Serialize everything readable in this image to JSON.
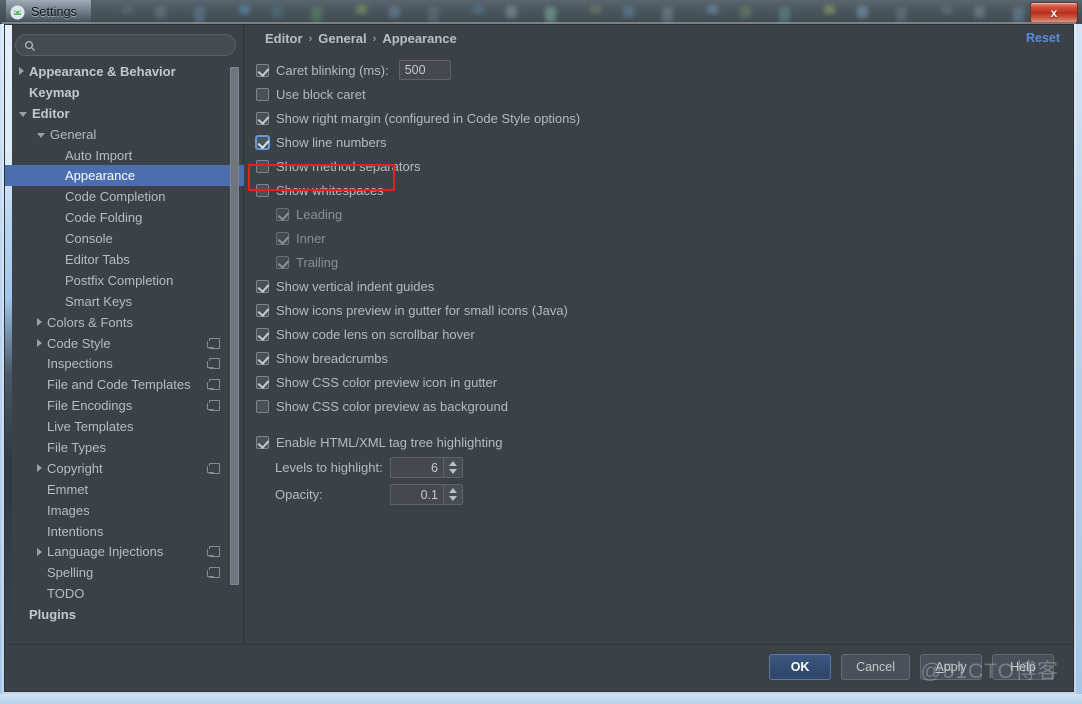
{
  "window": {
    "title": "Settings",
    "app_icon": "android-studio-icon",
    "close_label": "x"
  },
  "search": {
    "value": "",
    "placeholder": "",
    "icon": "search-icon"
  },
  "sidebar": {
    "items": [
      {
        "label": "Appearance & Behavior",
        "indent": 0,
        "twisty": "right",
        "bold": true,
        "selected": false,
        "badge": false
      },
      {
        "label": "Keymap",
        "indent": 0,
        "twisty": "none",
        "bold": true,
        "selected": false,
        "badge": false
      },
      {
        "label": "Editor",
        "indent": 0,
        "twisty": "down",
        "bold": true,
        "selected": false,
        "badge": false
      },
      {
        "label": "General",
        "indent": 1,
        "twisty": "down",
        "bold": false,
        "selected": false,
        "badge": false
      },
      {
        "label": "Auto Import",
        "indent": 2,
        "twisty": "none",
        "bold": false,
        "selected": false,
        "badge": false
      },
      {
        "label": "Appearance",
        "indent": 2,
        "twisty": "none",
        "bold": false,
        "selected": true,
        "badge": false
      },
      {
        "label": "Code Completion",
        "indent": 2,
        "twisty": "none",
        "bold": false,
        "selected": false,
        "badge": false
      },
      {
        "label": "Code Folding",
        "indent": 2,
        "twisty": "none",
        "bold": false,
        "selected": false,
        "badge": false
      },
      {
        "label": "Console",
        "indent": 2,
        "twisty": "none",
        "bold": false,
        "selected": false,
        "badge": false
      },
      {
        "label": "Editor Tabs",
        "indent": 2,
        "twisty": "none",
        "bold": false,
        "selected": false,
        "badge": false
      },
      {
        "label": "Postfix Completion",
        "indent": 2,
        "twisty": "none",
        "bold": false,
        "selected": false,
        "badge": false
      },
      {
        "label": "Smart Keys",
        "indent": 2,
        "twisty": "none",
        "bold": false,
        "selected": false,
        "badge": false
      },
      {
        "label": "Colors & Fonts",
        "indent": 1,
        "twisty": "right",
        "bold": false,
        "selected": false,
        "badge": false
      },
      {
        "label": "Code Style",
        "indent": 1,
        "twisty": "right",
        "bold": false,
        "selected": false,
        "badge": true
      },
      {
        "label": "Inspections",
        "indent": 1,
        "twisty": "none",
        "bold": false,
        "selected": false,
        "badge": true
      },
      {
        "label": "File and Code Templates",
        "indent": 1,
        "twisty": "none",
        "bold": false,
        "selected": false,
        "badge": true
      },
      {
        "label": "File Encodings",
        "indent": 1,
        "twisty": "none",
        "bold": false,
        "selected": false,
        "badge": true
      },
      {
        "label": "Live Templates",
        "indent": 1,
        "twisty": "none",
        "bold": false,
        "selected": false,
        "badge": false
      },
      {
        "label": "File Types",
        "indent": 1,
        "twisty": "none",
        "bold": false,
        "selected": false,
        "badge": false
      },
      {
        "label": "Copyright",
        "indent": 1,
        "twisty": "right",
        "bold": false,
        "selected": false,
        "badge": true
      },
      {
        "label": "Emmet",
        "indent": 1,
        "twisty": "none",
        "bold": false,
        "selected": false,
        "badge": false
      },
      {
        "label": "Images",
        "indent": 1,
        "twisty": "none",
        "bold": false,
        "selected": false,
        "badge": false
      },
      {
        "label": "Intentions",
        "indent": 1,
        "twisty": "none",
        "bold": false,
        "selected": false,
        "badge": false
      },
      {
        "label": "Language Injections",
        "indent": 1,
        "twisty": "right",
        "bold": false,
        "selected": false,
        "badge": true
      },
      {
        "label": "Spelling",
        "indent": 1,
        "twisty": "none",
        "bold": false,
        "selected": false,
        "badge": true
      },
      {
        "label": "TODO",
        "indent": 1,
        "twisty": "none",
        "bold": false,
        "selected": false,
        "badge": false
      },
      {
        "label": "Plugins",
        "indent": 0,
        "twisty": "none",
        "bold": true,
        "selected": false,
        "badge": false
      }
    ]
  },
  "main": {
    "breadcrumb": [
      "Editor",
      "General",
      "Appearance"
    ],
    "breadcrumb_separator": "›",
    "reset_label": "Reset",
    "options": [
      {
        "id": "caret-blinking",
        "label": "Caret blinking (ms):",
        "checked": true,
        "state": "normal",
        "indent": 0,
        "field": "500"
      },
      {
        "id": "use-block-caret",
        "label": "Use block caret",
        "checked": false,
        "state": "normal",
        "indent": 0
      },
      {
        "id": "show-right-margin",
        "label": "Show right margin (configured in Code Style options)",
        "checked": true,
        "state": "normal",
        "indent": 0
      },
      {
        "id": "show-line-numbers",
        "label": "Show line numbers",
        "checked": true,
        "state": "focus",
        "indent": 0
      },
      {
        "id": "show-method-separators",
        "label": "Show method separators",
        "checked": false,
        "state": "normal",
        "indent": 0
      },
      {
        "id": "show-whitespaces",
        "label": "Show whitespaces",
        "checked": false,
        "state": "normal",
        "indent": 0
      },
      {
        "id": "whitespace-leading",
        "label": "Leading",
        "checked": true,
        "state": "dimmed",
        "indent": 1
      },
      {
        "id": "whitespace-inner",
        "label": "Inner",
        "checked": true,
        "state": "dimmed",
        "indent": 1
      },
      {
        "id": "whitespace-trailing",
        "label": "Trailing",
        "checked": true,
        "state": "dimmed",
        "indent": 1
      },
      {
        "id": "show-vertical-indent-guides",
        "label": "Show vertical indent guides",
        "checked": true,
        "state": "normal",
        "indent": 0
      },
      {
        "id": "show-icons-preview-gutter",
        "label": "Show icons preview in gutter for small icons (Java)",
        "checked": true,
        "state": "normal",
        "indent": 0
      },
      {
        "id": "show-code-lens",
        "label": "Show code lens on scrollbar hover",
        "checked": true,
        "state": "normal",
        "indent": 0
      },
      {
        "id": "show-breadcrumbs",
        "label": "Show breadcrumbs",
        "checked": true,
        "state": "normal",
        "indent": 0
      },
      {
        "id": "show-css-color-icon",
        "label": "Show CSS color preview icon in gutter",
        "checked": true,
        "state": "normal",
        "indent": 0
      },
      {
        "id": "show-css-color-background",
        "label": "Show CSS color preview as background",
        "checked": false,
        "state": "normal",
        "indent": 0
      }
    ],
    "html_section": {
      "enable_label": "Enable HTML/XML tag tree highlighting",
      "enable_checked": true,
      "levels_label": "Levels to highlight:",
      "levels_value": "6",
      "opacity_label": "Opacity:",
      "opacity_value": "0.1"
    },
    "annotation": {
      "type": "red-rectangle",
      "target": "show-line-numbers",
      "color": "#ee1c1c"
    }
  },
  "footer": {
    "ok_label": "OK",
    "cancel_label": "Cancel",
    "apply_label": "Apply",
    "apply_mnemonic": "A",
    "help_label": "Help"
  },
  "watermark": {
    "text": "@51CTO博客"
  },
  "colors": {
    "dialog_bg": "#3c4147",
    "selection": "#4b6eaf",
    "link": "#5a8bd6",
    "annotation": "#ee1c1c",
    "text": "#b4bac0"
  }
}
